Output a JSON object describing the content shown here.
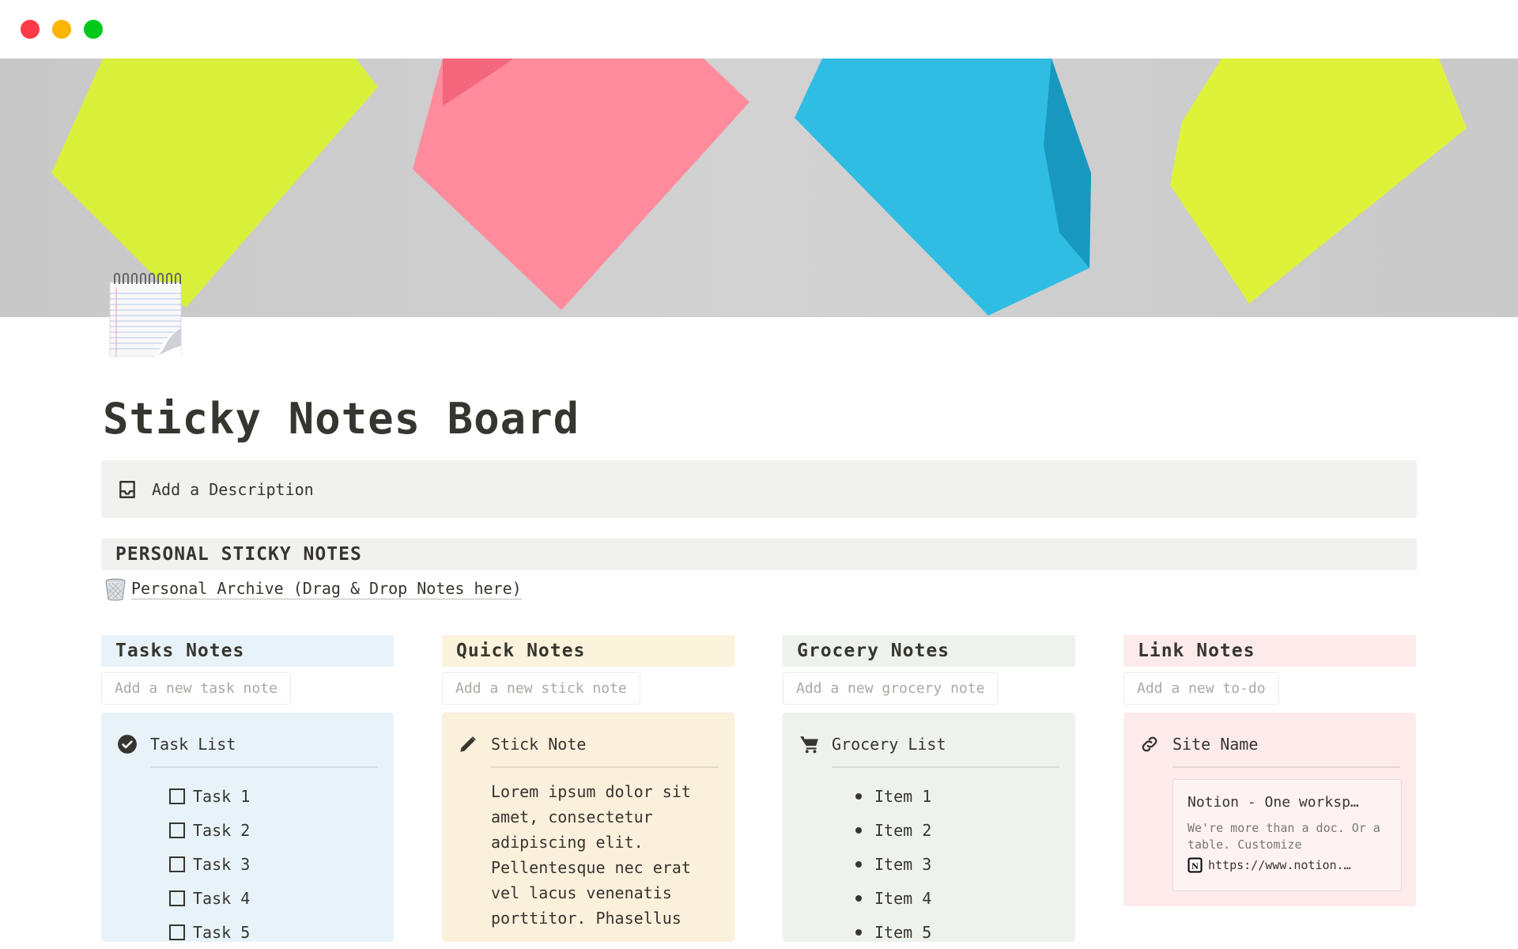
{
  "window": {
    "controls": [
      "close",
      "minimize",
      "maximize"
    ]
  },
  "page": {
    "title": "Sticky Notes Board",
    "icon": "notepad-icon",
    "cover": "sticky-notes-photo"
  },
  "description": {
    "icon": "inbox-icon",
    "label": "Add a Description"
  },
  "section": {
    "title": "PERSONAL STICKY NOTES"
  },
  "archive": {
    "icon": "wastebasket-icon",
    "label": "Personal Archive (Drag & Drop Notes here)"
  },
  "colors": {
    "tasks": "#e7f3f8",
    "quick": "#fbf3db",
    "grocery": "#edf3ec",
    "link": "#fdebec",
    "text": "#37352f",
    "muted": "#a9a8a4"
  },
  "columns": [
    {
      "title": "Tasks Notes",
      "input_placeholder": "Add a new task note",
      "card": {
        "icon": "check-circle-icon",
        "title": "Task List",
        "items": [
          "Task 1",
          "Task 2",
          "Task 3",
          "Task 4",
          "Task 5"
        ]
      }
    },
    {
      "title": "Quick Notes",
      "input_placeholder": "Add a new stick note",
      "card": {
        "icon": "pencil-icon",
        "title": "Stick Note",
        "body": "Lorem ipsum dolor sit amet, consectetur adipiscing elit. Pellentesque nec erat vel lacus venenatis porttitor. Phasellus"
      }
    },
    {
      "title": "Grocery Notes",
      "input_placeholder": "Add a new grocery note",
      "card": {
        "icon": "cart-icon",
        "title": "Grocery List",
        "items": [
          "Item 1",
          "Item 2",
          "Item 3",
          "Item 4",
          "Item 5"
        ]
      }
    },
    {
      "title": "Link Notes",
      "input_placeholder": "Add a new to-do",
      "card": {
        "icon": "link-icon",
        "title": "Site Name",
        "bookmark": {
          "title": "Notion - One worksp…",
          "description": "We're more than a doc. Or a table. Customize",
          "url": "https://www.notion.…",
          "favicon": "notion-logo-icon"
        }
      }
    }
  ]
}
